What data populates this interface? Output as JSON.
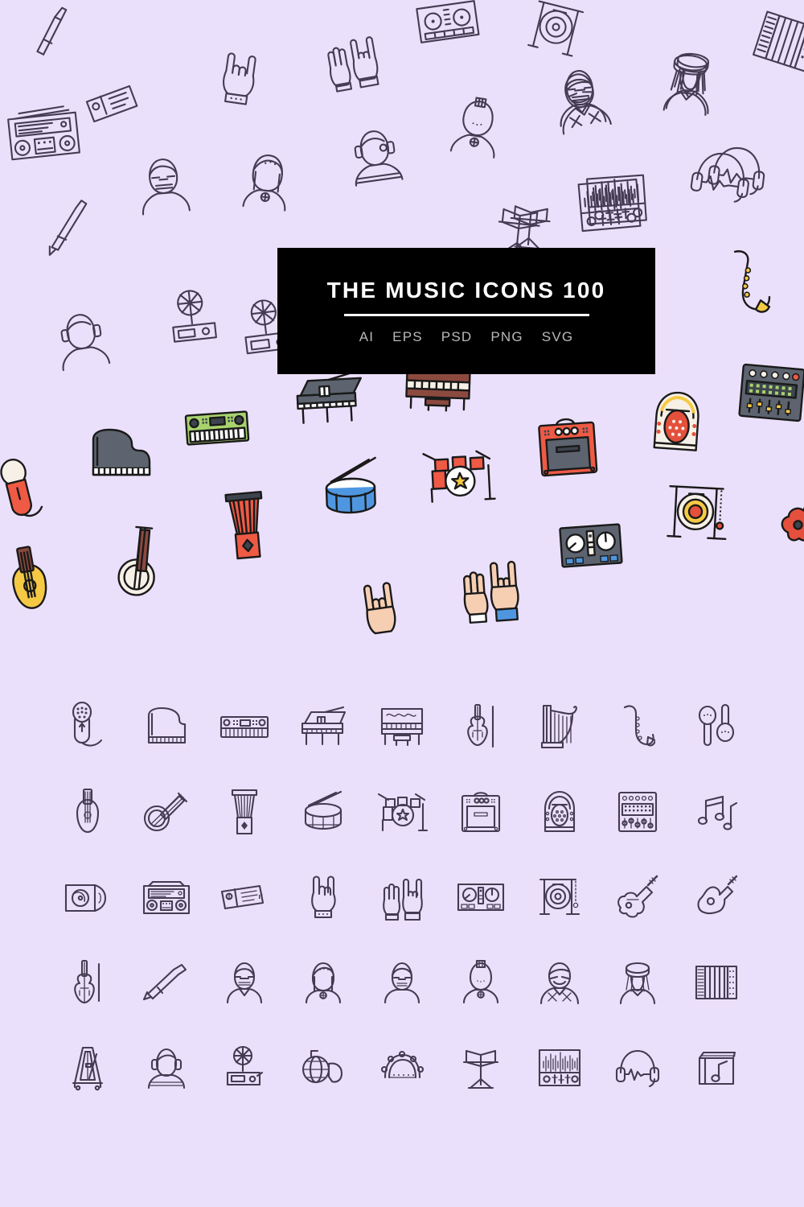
{
  "page": {
    "background_color": "#ebe0fb",
    "icon_stroke_color": "#443c52",
    "title_banner_color": "#000000"
  },
  "banner": {
    "title": "THE MUSIC ICONS 100",
    "formats": [
      "AI",
      "EPS",
      "PSD",
      "PNG",
      "SVG"
    ]
  },
  "grid": {
    "columns": 9,
    "rows": 5,
    "icons": [
      "microphone",
      "grand-piano-top",
      "synthesizer-keyboard",
      "grand-piano",
      "upright-piano",
      "violin",
      "harp",
      "saxophone",
      "maracas",
      "oud-lute",
      "banjo",
      "djembe",
      "snare-drum",
      "drum-kit",
      "guitar-amplifier",
      "jukebox",
      "audio-mixer",
      "music-notes",
      "cd-album",
      "boombox",
      "concert-tickets",
      "rock-hand",
      "raised-hands",
      "dj-controller",
      "gong",
      "electric-guitar",
      "acoustic-guitar",
      "double-bass",
      "trombone",
      "musician-man-glasses",
      "musician-woman",
      "musician-man-beanie",
      "musician-woman-headband",
      "musician-man-bowtie",
      "musician-woman-hat",
      "accordion",
      "metronome",
      "person-headphones",
      "gramophone",
      "french-horn",
      "tambourine",
      "music-stand",
      "audio-interface",
      "headphones",
      "vinyl-records-box"
    ]
  },
  "hero": {
    "palette": {
      "red": "#ef5a45",
      "red_deep": "#e4503c",
      "blue": "#4f96e0",
      "yellow": "#f6c945",
      "green": "#a7d26d",
      "gray": "#5d6470",
      "gray_dark": "#3e444e",
      "cream": "#f6f0e6",
      "skin": "#f6ceb2",
      "brown": "#8c4a3f",
      "white": "#ffffff",
      "outline": "#1a1a1a"
    },
    "colored_icons": [
      "microphone",
      "grand-piano-top",
      "synthesizer-keyboard",
      "grand-piano",
      "upright-piano",
      "oud-lute",
      "banjo",
      "djembe",
      "snare-drum",
      "drum-kit",
      "guitar-amplifier",
      "jukebox",
      "audio-mixer",
      "dj-controller",
      "gong",
      "electric-guitar",
      "raised-hands",
      "rock-hand"
    ],
    "outline_icons": [
      "trombone",
      "concert-tickets",
      "rock-hand",
      "dj-controller",
      "gong",
      "raised-hands",
      "boombox",
      "musician-man-glasses",
      "musician-woman",
      "musician-man-beanie",
      "musician-woman-headband",
      "musician-man-bowtie",
      "musician-woman-hat",
      "accordion",
      "headphones",
      "audio-interface",
      "music-stand",
      "person-headphones",
      "gramophone",
      "saxophone",
      "violin"
    ]
  }
}
